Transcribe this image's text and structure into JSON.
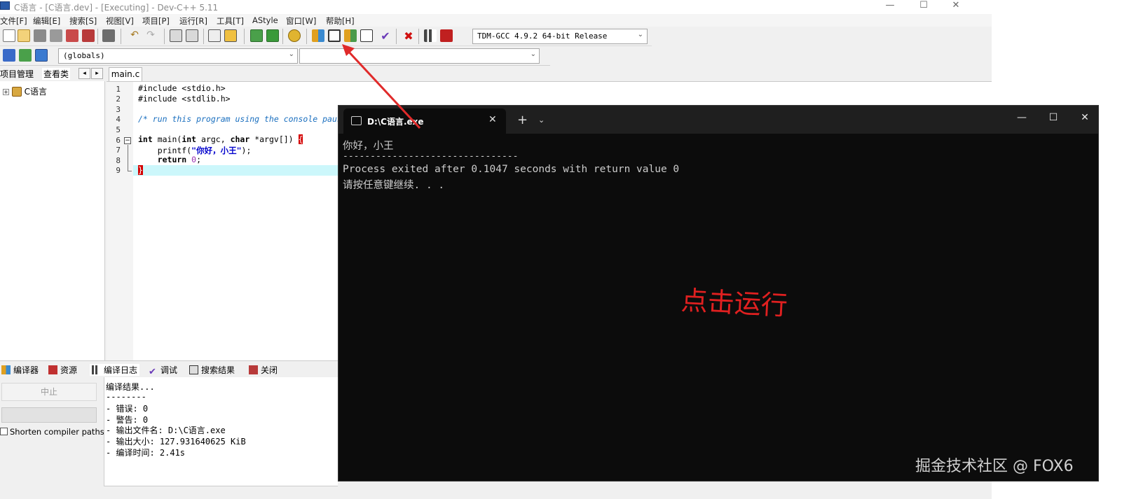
{
  "ide": {
    "window_title": "C语言 - [C语言.dev] - [Executing] - Dev-C++ 5.11",
    "menu": [
      "文件[F]",
      "编辑[E]",
      "搜索[S]",
      "视图[V]",
      "项目[P]",
      "运行[R]",
      "工具[T]",
      "AStyle",
      "窗口[W]",
      "帮助[H]"
    ],
    "compiler_select": "TDM-GCC 4.9.2 64-bit Release",
    "scope_select": "(globals)",
    "symbol_select": "",
    "left_tabs": [
      "项目管理",
      "查看类"
    ],
    "tree_root": "C语言",
    "editor_tab": "main.c",
    "code": {
      "line_numbers": [
        "1",
        "2",
        "3",
        "4",
        "5",
        "6",
        "7",
        "8",
        "9"
      ],
      "l1": "#include <stdio.h>",
      "l2": "#include <stdlib.h>",
      "l4": "/* run this program using the console paus",
      "l6_a": "int",
      "l6_b": " main(",
      "l6_c": "int",
      "l6_d": " argc, ",
      "l6_e": "char",
      "l6_f": " *argv[]) ",
      "l6_g": "{",
      "l7_a": "    printf(",
      "l7_b": "\"你好，小王\"",
      "l7_c": ");",
      "l8_a": "    return ",
      "l8_b": "0",
      "l8_c": ";",
      "l9": "}"
    },
    "bottom_tabs": [
      "编译器",
      "资源",
      "编译日志",
      "调试",
      "搜索结果",
      "关闭"
    ],
    "stop_button": "中止",
    "shorten_paths": "Shorten compiler paths",
    "log": [
      "编译结果...",
      "--------",
      "- 错误: 0",
      "- 警告: 0",
      "- 输出文件名: D:\\C语言.exe",
      "- 输出大小: 127.931640625 KiB",
      "- 编译时间: 2.41s"
    ]
  },
  "console": {
    "tab_title": "D:\\C语言.exe",
    "lines": [
      "你好，小王",
      "--------------------------------",
      "Process exited after 0.1047 seconds with return value 0",
      "请按任意键继续. . ."
    ],
    "window_controls": [
      "minimize-icon",
      "maximize-icon",
      "close-icon"
    ]
  },
  "annotation": "点击运行",
  "watermark": "掘金技术社区 @ FOX6",
  "colors": {
    "annotation": "#e02020",
    "console_bg": "#0c0c0c",
    "line_highlight": "#ccf7fb"
  }
}
